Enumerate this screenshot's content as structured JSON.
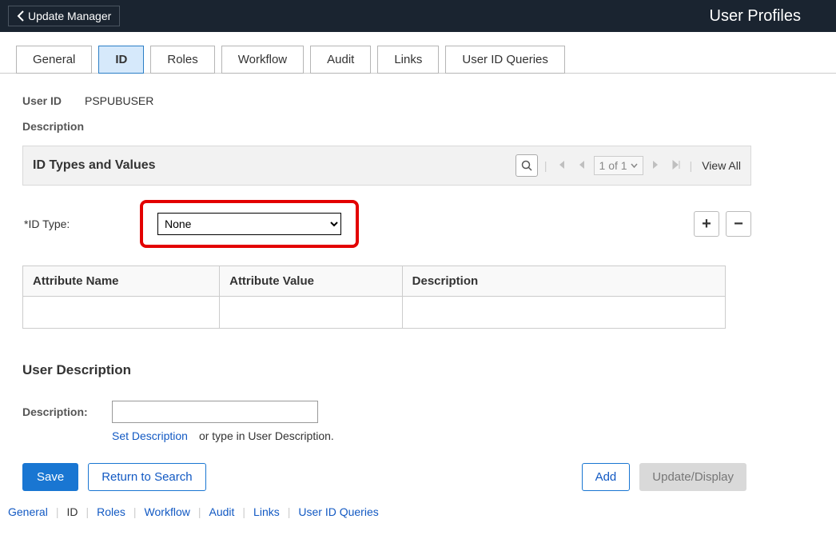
{
  "header": {
    "back_label": "Update Manager",
    "page_title": "User Profiles"
  },
  "tabs": [
    {
      "label": "General",
      "active": false
    },
    {
      "label": "ID",
      "active": true
    },
    {
      "label": "Roles",
      "active": false
    },
    {
      "label": "Workflow",
      "active": false
    },
    {
      "label": "Audit",
      "active": false
    },
    {
      "label": "Links",
      "active": false
    },
    {
      "label": "User ID Queries",
      "active": false
    }
  ],
  "user": {
    "id_label": "User ID",
    "id_value": "PSPUBUSER",
    "description_label": "Description"
  },
  "section": {
    "title": "ID Types and Values",
    "page_indicator": "1 of 1",
    "view_all": "View All"
  },
  "id_type": {
    "label": "*ID Type:",
    "selected": "None",
    "options": [
      "None"
    ]
  },
  "attr_table": {
    "headers": [
      "Attribute Name",
      "Attribute Value",
      "Description"
    ],
    "rows": [
      [
        "",
        "",
        ""
      ]
    ]
  },
  "user_description": {
    "heading": "User Description",
    "label": "Description:",
    "value": "",
    "set_description_link": "Set Description",
    "hint": "or type in User Description."
  },
  "actions": {
    "save": "Save",
    "return": "Return to Search",
    "add": "Add",
    "update": "Update/Display"
  },
  "bottom_nav": {
    "items": [
      "General",
      "ID",
      "Roles",
      "Workflow",
      "Audit",
      "Links",
      "User ID Queries"
    ],
    "current_index": 1
  }
}
